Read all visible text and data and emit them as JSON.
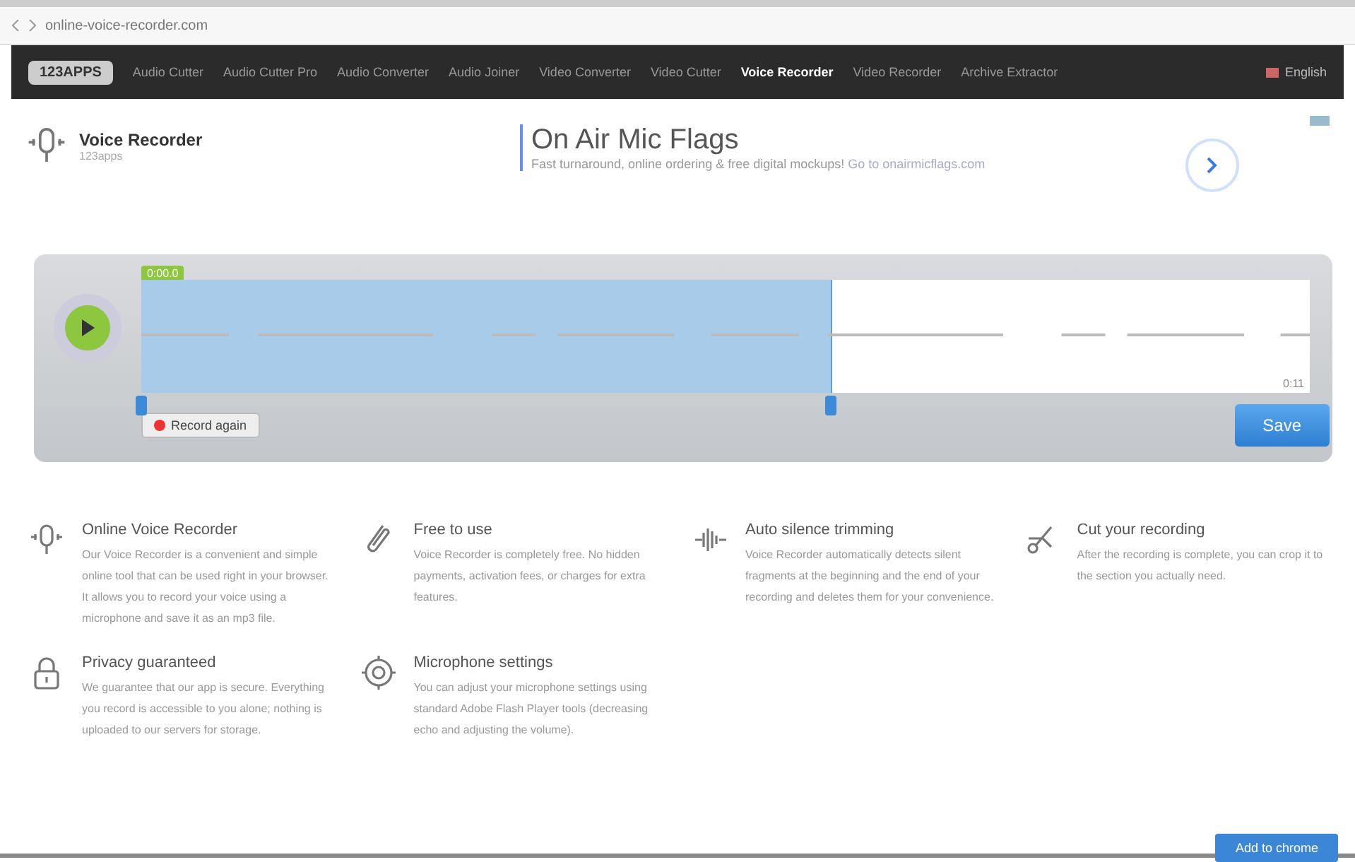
{
  "browser": {
    "url": "online-voice-recorder.com"
  },
  "nav": {
    "logo": "123APPS",
    "items": [
      {
        "label": "Audio Cutter",
        "selected": false
      },
      {
        "label": "Audio Cutter Pro",
        "selected": false
      },
      {
        "label": "Audio Converter",
        "selected": false
      },
      {
        "label": "Audio Joiner",
        "selected": false
      },
      {
        "label": "Video Converter",
        "selected": false
      },
      {
        "label": "Video Cutter",
        "selected": false
      },
      {
        "label": "Voice Recorder",
        "selected": true
      },
      {
        "label": "Video Recorder",
        "selected": false
      },
      {
        "label": "Archive Extractor",
        "selected": false
      }
    ],
    "language": "English"
  },
  "app": {
    "title": "Voice Recorder",
    "subtitle": "123apps"
  },
  "ad": {
    "title": "On Air Mic Flags",
    "text": "Fast turnaround, online ordering & free digital mockups!",
    "link": "Go to onairmicflags.com"
  },
  "recorder": {
    "position": "0:00.0",
    "duration": "0:11",
    "selection": {
      "level": 0.59
    },
    "record_again": "Record again",
    "save": "Save"
  },
  "features": [
    {
      "kind": "microphone",
      "title": "Online Voice Recorder",
      "text": "Our Voice Recorder is a convenient and simple online tool that can be used right in your browser. It allows you to record your voice using a microphone and save it as an mp3 file."
    },
    {
      "kind": "clip",
      "title": "Free to use",
      "text": "Voice Recorder is completely free. No hidden payments, activation fees, or charges for extra features."
    },
    {
      "kind": "wave",
      "title": "Auto silence trimming",
      "text": "Voice Recorder automatically detects silent fragments at the beginning and the end of your recording and deletes them for your convenience."
    },
    {
      "kind": "scissors",
      "title": "Cut your recording",
      "text": "After the recording is complete, you can crop it to the section you actually need."
    },
    {
      "kind": "lock",
      "title": "Privacy guaranteed",
      "text": "We guarantee that our app is secure. Everything you record is accessible to you alone; nothing is uploaded to our servers for storage."
    },
    {
      "kind": "gear",
      "title": "Microphone settings",
      "text": "You can adjust your microphone settings using standard Adobe Flash Player tools (decreasing echo and adjusting the volume)."
    }
  ],
  "extension_button": "Add to chrome"
}
